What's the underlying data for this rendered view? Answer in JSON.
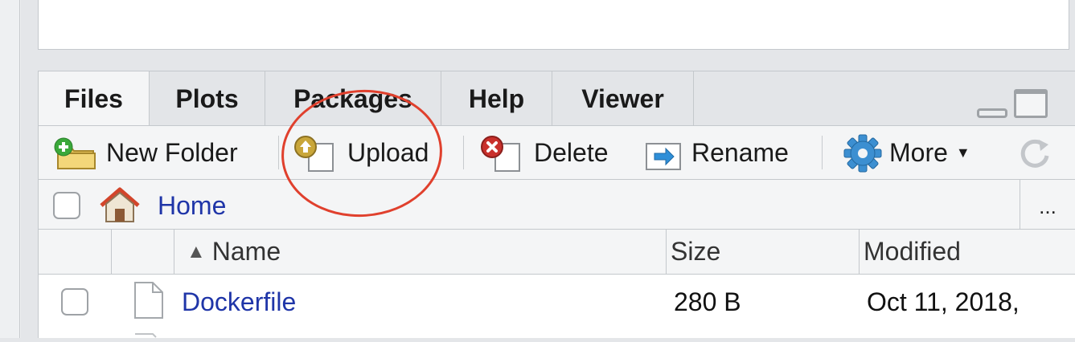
{
  "tabs": [
    "Files",
    "Plots",
    "Packages",
    "Help",
    "Viewer"
  ],
  "toolbar": {
    "new_folder": "New Folder",
    "upload": "Upload",
    "delete": "Delete",
    "rename": "Rename",
    "more": "More"
  },
  "breadcrumb": {
    "home": "Home",
    "more": "..."
  },
  "columns": {
    "name": "Name",
    "size": "Size",
    "modified": "Modified"
  },
  "files": [
    {
      "name": "Dockerfile",
      "size": "280 B",
      "modified": "Oct 11, 2018,"
    }
  ],
  "colors": {
    "link": "#1f35a8",
    "annotation": "#e0402d"
  },
  "icons": [
    "new-folder-icon",
    "upload-icon",
    "delete-icon",
    "rename-icon",
    "gear-icon",
    "refresh-icon",
    "home-icon",
    "file-icon",
    "sort-up-icon",
    "minimize-icon",
    "maximize-icon"
  ]
}
